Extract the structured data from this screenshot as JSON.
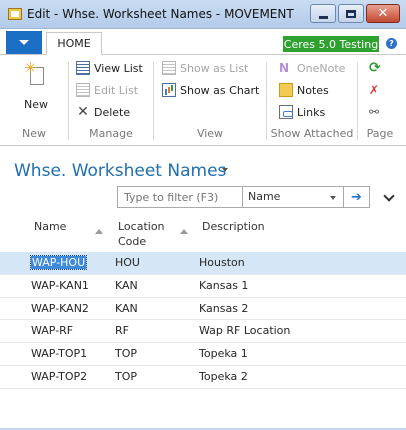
{
  "window": {
    "title": "Edit - Whse. Worksheet Names - MOVEMENT Mo...",
    "minimize_label": "Minimize",
    "maximize_label": "Maximize",
    "close_label": "✕"
  },
  "ribbon": {
    "tabs": [
      "HOME"
    ],
    "company_badge": "Ceres 5.0 Testing",
    "help_label": "?",
    "groups": {
      "new": {
        "label": "New",
        "button": "New"
      },
      "manage": {
        "label": "Manage",
        "view_list": "View List",
        "edit_list": "Edit List",
        "delete": "Delete"
      },
      "view": {
        "label": "View",
        "show_as_list": "Show as List",
        "show_as_chart": "Show as Chart"
      },
      "show_attached": {
        "label": "Show Attached",
        "onenote": "OneNote",
        "notes": "Notes",
        "links": "Links"
      },
      "page": {
        "label": "Page"
      }
    },
    "accent": "#1a6fc4",
    "badge_color": "#2ea12e"
  },
  "page": {
    "title": "Whse. Worksheet Names"
  },
  "filter": {
    "placeholder": "Type to filter (F3)",
    "field": "Name",
    "go_icon": "arrow-right-icon"
  },
  "grid": {
    "columns": {
      "name": "Name",
      "location_line1": "Location",
      "location_line2": "Code",
      "description": "Description"
    },
    "rows": [
      {
        "name": "WAP-HOU",
        "location": "HOU",
        "description": "Houston"
      },
      {
        "name": "WAP-KAN1",
        "location": "KAN",
        "description": "Kansas 1"
      },
      {
        "name": "WAP-KAN2",
        "location": "KAN",
        "description": "Kansas 2"
      },
      {
        "name": "WAP-RF",
        "location": "RF",
        "description": "Wap RF Location"
      },
      {
        "name": "WAP-TOP1",
        "location": "TOP",
        "description": "Topeka 1"
      },
      {
        "name": "WAP-TOP2",
        "location": "TOP",
        "description": "Topeka 2"
      }
    ],
    "selected_row": 0
  }
}
